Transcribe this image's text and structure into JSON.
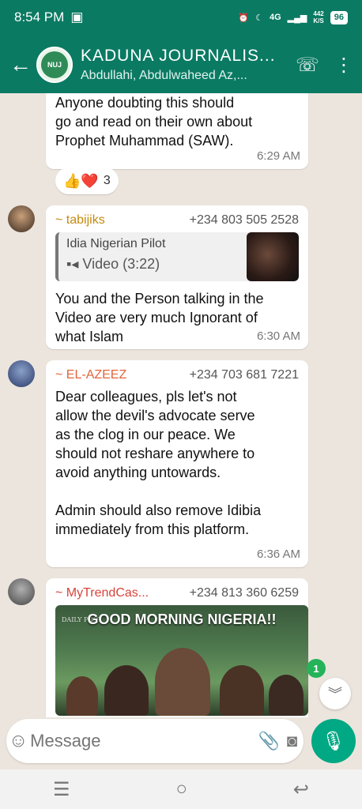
{
  "status": {
    "time": "8:54 PM",
    "network": "4G",
    "speed": "442\nK/S",
    "battery": "96"
  },
  "header": {
    "title": "KADUNA JOURNALIS...",
    "subtitle": "Abdullahi, Abdulwaheed Az,...",
    "avatar_text": "NUJ"
  },
  "messages": [
    {
      "text": "Anyone doubting this should\ngo and read on their own about\nProphet Muhammad (SAW).",
      "time": "6:29 AM",
      "reactions": {
        "emojis": "👍❤️",
        "count": "3"
      }
    },
    {
      "sender": "~ tabijiks",
      "phone": "+234 803 505 2528",
      "quote_title": "Idia Nigerian Pilot",
      "quote_sub": "Video (3:22)",
      "text": "You and the Person talking in the\nVideo are very much Ignorant of\nwhat Islam",
      "time": "6:30 AM",
      "sender_color": "#c48a0f"
    },
    {
      "sender": "~ EL-AZEEZ",
      "phone": "+234 703 681 7221",
      "text": "Dear colleagues, pls let's not\nallow the devil's advocate serve\nas the clog in our peace. We\nshould not reshare anywhere to\navoid anything untowards.\n\nAdmin should also remove Idibia\nimmediately from this platform.",
      "time": "6:36 AM",
      "sender_color": "#e0663a"
    },
    {
      "sender": "~ MyTrendCas...",
      "phone": "+234 813 360 6259",
      "photo_title": "GOOD MORNING NIGERIA!!",
      "photo_brand": "DAILY POST",
      "sender_color": "#d8433b"
    }
  ],
  "unread_count": "1",
  "composer": {
    "placeholder": "Message"
  },
  "colors": {
    "header": "#0b7a63",
    "mic": "#00a884",
    "chat_bg": "#ece5dd"
  },
  "icons": [
    "back-arrow-icon",
    "add-call-icon",
    "more-icon",
    "emoji-icon",
    "attach-icon",
    "camera-icon",
    "mic-icon",
    "chevron-down-icon"
  ]
}
